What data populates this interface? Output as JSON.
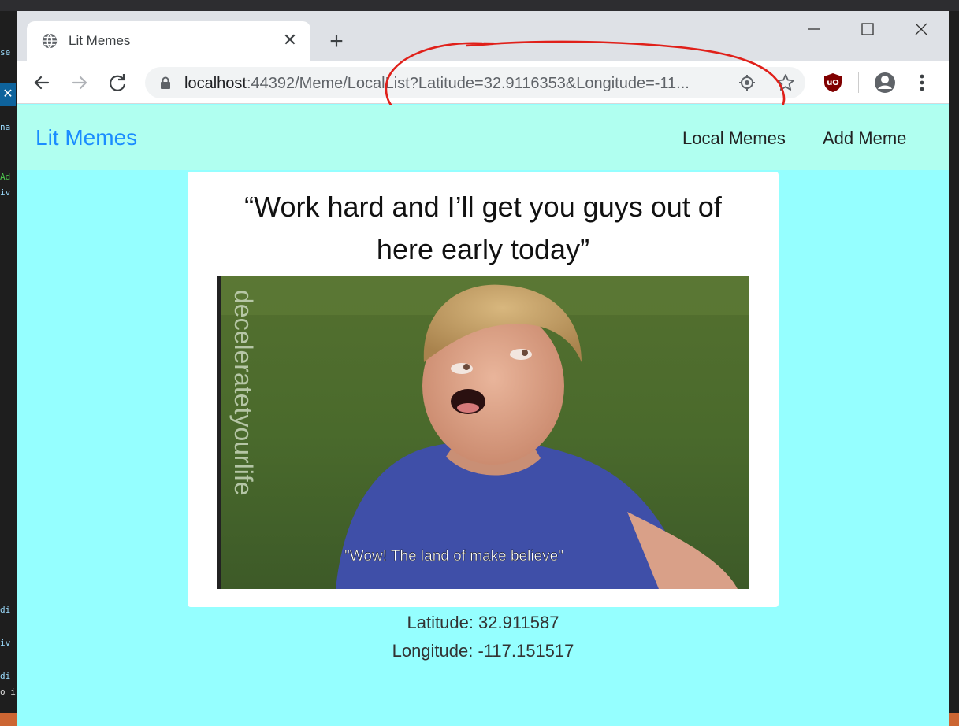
{
  "background": {
    "code_lines": [
      "na",
      "Ad",
      "iv",
      "di",
      "iv",
      "di"
    ],
    "left_top_text": "se",
    "bottom_text": "o is"
  },
  "browser": {
    "tab": {
      "title": "Lit Memes",
      "icon": "globe-icon",
      "close_icon": "close-icon"
    },
    "new_tab_icon": "plus-icon",
    "window_controls": [
      "minimize-icon",
      "maximize-icon",
      "close-icon"
    ],
    "address": {
      "host": "localhost",
      "path": ":44392/Meme/LocalList?Latitude=32.9116353&Longitude=-11..."
    },
    "toolbar_icons": [
      "back-icon",
      "forward-icon",
      "reload-icon",
      "lock-icon",
      "location-icon",
      "star-icon",
      "ublock-icon",
      "profile-icon",
      "menu-icon"
    ]
  },
  "site": {
    "brand": "Lit Memes",
    "nav": {
      "local": "Local Memes",
      "add": "Add Meme"
    }
  },
  "meme": {
    "caption_line1": "“Work hard and I’ll get you guys out of",
    "caption_line2": "here early today”",
    "watermark": "deceleratetyourlife",
    "subtitle": "\"Wow! The land of make believe\""
  },
  "location": {
    "latitude_label": "Latitude: 32.911587",
    "longitude_label": "Longitude: -117.151517"
  },
  "colors": {
    "page_bg": "#95ffff",
    "nav_bg": "#b0fff0",
    "brand": "#1a8cff",
    "annotation": "#e0201a"
  }
}
